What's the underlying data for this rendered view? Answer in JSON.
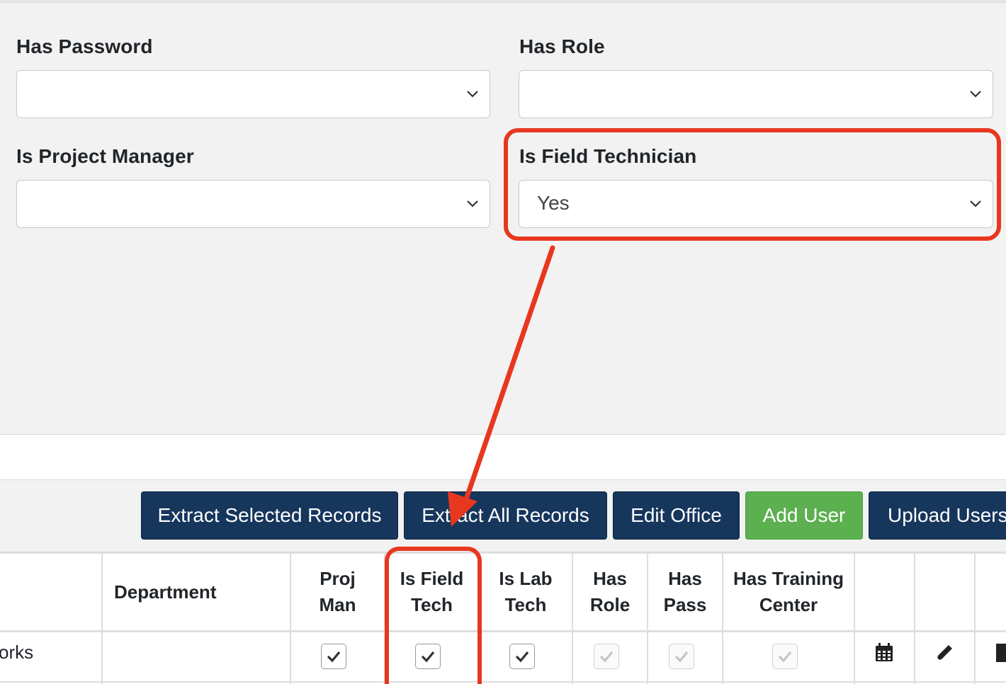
{
  "filters": {
    "has_password": {
      "label": "Has Password",
      "value": ""
    },
    "has_role": {
      "label": "Has Role",
      "value": ""
    },
    "is_project_manager": {
      "label": "Is Project Manager",
      "value": ""
    },
    "is_field_technician": {
      "label": "Is Field Technician",
      "value": "Yes"
    }
  },
  "toolbar": {
    "extract_selected": "Extract Selected Records",
    "extract_all": "Extract All Records",
    "edit_office": "Edit Office",
    "add_user": "Add User",
    "upload_users": "Upload Users"
  },
  "table": {
    "headers": {
      "department": "Department",
      "proj_man": [
        "Proj",
        "Man"
      ],
      "is_field_tech": [
        "Is Field",
        "Tech"
      ],
      "is_lab_tech": [
        "Is Lab",
        "Tech"
      ],
      "has_role": [
        "Has",
        "Role"
      ],
      "has_pass": [
        "Has",
        "Pass"
      ],
      "has_training_center": [
        "Has Training",
        "Center"
      ]
    },
    "rows": [
      {
        "name_fragment": "orks",
        "department": "",
        "proj_man": true,
        "is_field_tech": true,
        "is_lab_tech": true,
        "has_role": true,
        "has_pass": true,
        "has_training_center": true
      }
    ]
  },
  "icons": {
    "chevron": "chevron-down-icon",
    "calendar": "calendar-icon",
    "edit": "pencil-icon",
    "check": "check-icon"
  },
  "colors": {
    "navy": "#16365c",
    "green": "#5cb050",
    "annotation": "#e8371f"
  }
}
